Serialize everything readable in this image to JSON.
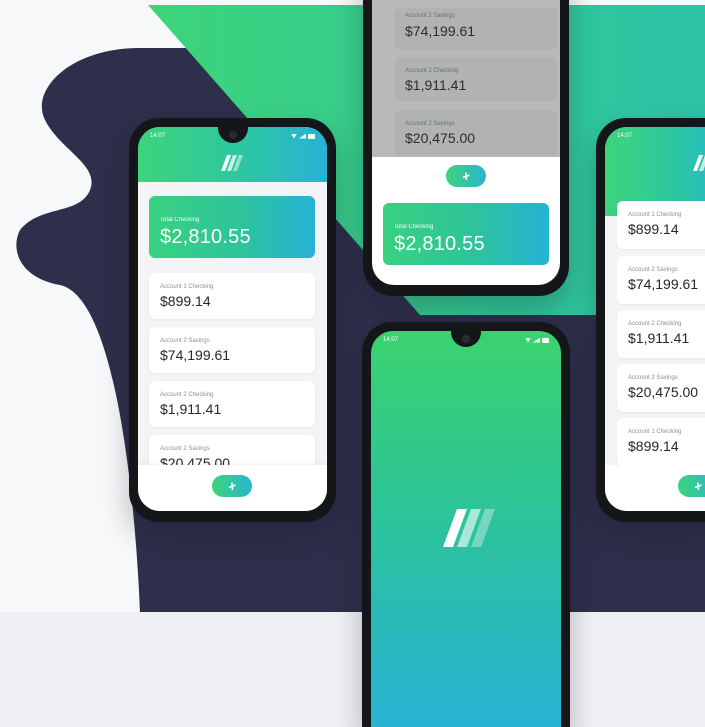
{
  "phone_left": {
    "status_time": "14:07",
    "total": {
      "label": "Total Checking",
      "value": "$2,810.55"
    },
    "accounts": [
      {
        "label": "Account 1 Checking",
        "value": "$899.14"
      },
      {
        "label": "Account 2 Savings",
        "value": "$74,199.61"
      },
      {
        "label": "Account 2 Checking",
        "value": "$1,911.41"
      },
      {
        "label": "Account 2 Savings",
        "value": "$20,475.00"
      }
    ],
    "add_icon": "+"
  },
  "phone_top_middle": {
    "accounts": [
      {
        "label": "Account 2 Savings",
        "value": "$74,199.61"
      },
      {
        "label": "Account 2 Checking",
        "value": "$1,911.41"
      },
      {
        "label": "Account 2 Savings",
        "value": "$20,475.00"
      }
    ],
    "add_icon": "+",
    "total": {
      "label": "Total Checking",
      "value": "$2,810.55"
    }
  },
  "phone_splash": {
    "status_time": "14:07"
  },
  "phone_right": {
    "status_time": "14:07",
    "accounts": [
      {
        "label": "Account 1 Checking",
        "value": "$899.14"
      },
      {
        "label": "Account 2 Savings",
        "value": "$74,199.61"
      },
      {
        "label": "Account 2 Checking",
        "value": "$1,911.41"
      },
      {
        "label": "Account 2 Savings",
        "value": "$20,475.00"
      },
      {
        "label": "Account 1 Checking",
        "value": "$899.14"
      }
    ]
  },
  "colors": {
    "navy": "#2e2f4a",
    "green": "#3dd47a",
    "teal": "#2cc7a2",
    "blue": "#27b3d6"
  },
  "icons": [
    "brand-slashes-logo",
    "plus-icon",
    "signal-icon",
    "wifi-icon",
    "battery-icon"
  ]
}
